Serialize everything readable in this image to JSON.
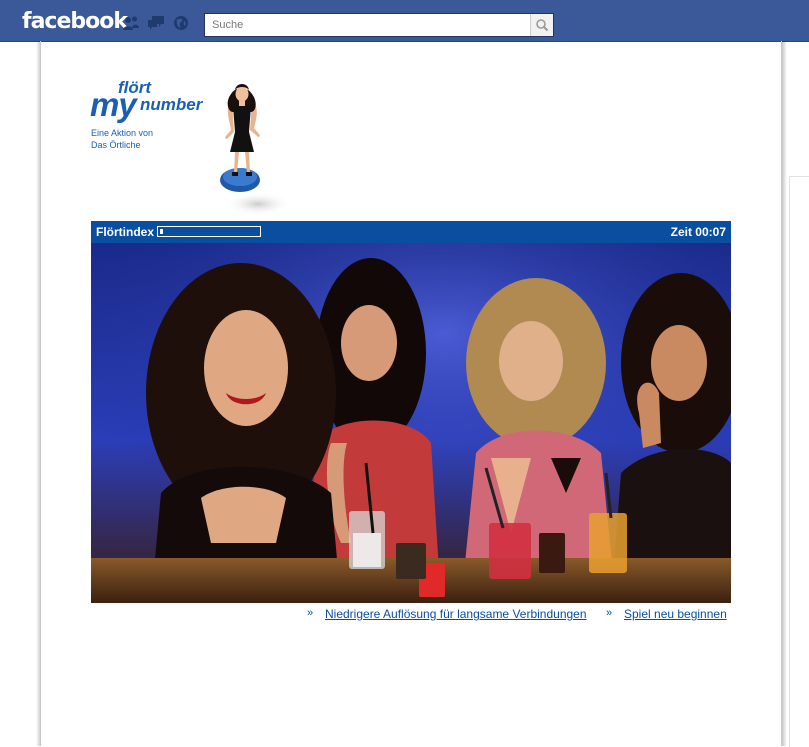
{
  "facebook": {
    "logo_text": "facebook",
    "icons": [
      "friend-requests-icon",
      "messages-icon",
      "notifications-globe-icon",
      "search-icon"
    ],
    "search_placeholder": "Suche"
  },
  "app": {
    "logo": {
      "flort": "flört",
      "my": "my",
      "number": "number",
      "line1": "Eine Aktion von",
      "line2": "Das Örtliche"
    },
    "game": {
      "index_label": "Flörtindex",
      "flirt_index_progress": 0.03,
      "time_label": "Zeit 00:07"
    },
    "links": {
      "arrow": "»",
      "lower_resolution": "Niedrigere Auflösung für langsame Verbindungen",
      "restart": "Spiel neu beginnen"
    }
  },
  "colors": {
    "facebook_blue": "#3b5998",
    "app_blue": "#0a4ea0",
    "logo_blue": "#1a5fb4"
  }
}
